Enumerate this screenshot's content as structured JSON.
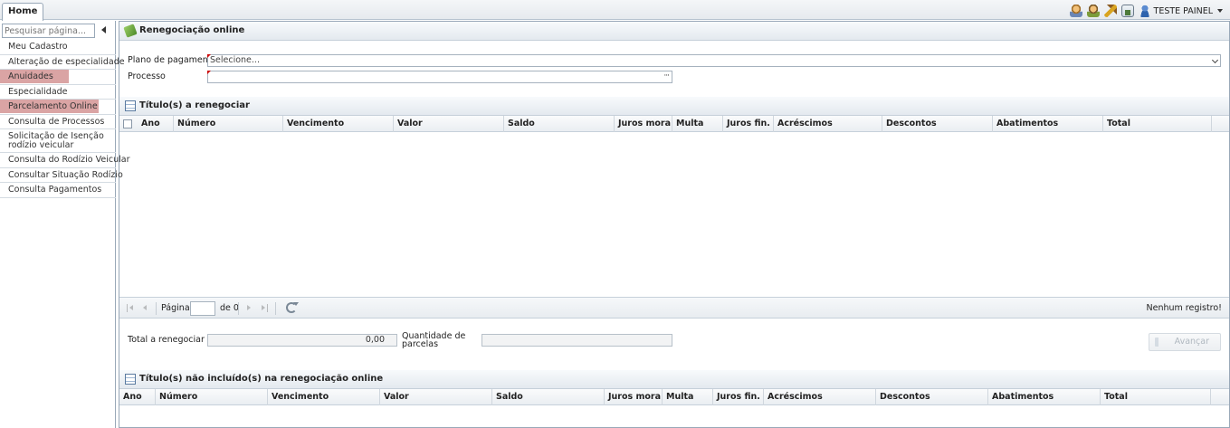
{
  "tabs": {
    "home": "Home"
  },
  "user": {
    "name": "TESTE PAINEL"
  },
  "sidebar": {
    "search_placeholder": "Pesquisar página...",
    "items": [
      {
        "label": "Meu Cadastro",
        "highlight": false
      },
      {
        "label": "Alteração de especialidade",
        "highlight": false
      },
      {
        "label": "Anuidades",
        "highlight": true
      },
      {
        "label": "Especialidade",
        "highlight": false
      },
      {
        "label": "Parcelamento Online",
        "highlight": true
      },
      {
        "label": "Consulta de Processos",
        "highlight": false
      },
      {
        "label": "Solicitação de Isenção rodízio veicular",
        "highlight": false
      },
      {
        "label": "Consulta do Rodízio Veicular",
        "highlight": false
      },
      {
        "label": "Consultar Situação Rodízio",
        "highlight": false
      },
      {
        "label": "Consulta Pagamentos",
        "highlight": false
      }
    ]
  },
  "main": {
    "title": "Renegociação online",
    "form": {
      "plano_label": "Plano de pagamento",
      "plano_placeholder": "Selecione...",
      "processo_label": "Processo",
      "processo_value": ""
    },
    "grid1": {
      "title": "Título(s) a renegociar",
      "columns": [
        "Ano",
        "Número",
        "Vencimento",
        "Valor",
        "Saldo",
        "Juros mora",
        "Multa",
        "Juros fin.",
        "Acréscimos",
        "Descontos",
        "Abatimentos",
        "Total"
      ]
    },
    "paging": {
      "page_label": "Página",
      "page_value": "",
      "of_label": "de 0",
      "status": "Nenhum registro!"
    },
    "totals": {
      "total_label": "Total a renegociar",
      "total_value": "0,00",
      "parcelas_label": "Quantidade de parcelas",
      "parcelas_value": "",
      "advance_label": "Avançar"
    },
    "grid2": {
      "title": "Título(s) não incluído(s) na renegociação online",
      "columns": [
        "Ano",
        "Número",
        "Vencimento",
        "Valor",
        "Saldo",
        "Juros mora",
        "Multa",
        "Juros fin.",
        "Acréscimos",
        "Descontos",
        "Abatimentos",
        "Total"
      ]
    }
  }
}
